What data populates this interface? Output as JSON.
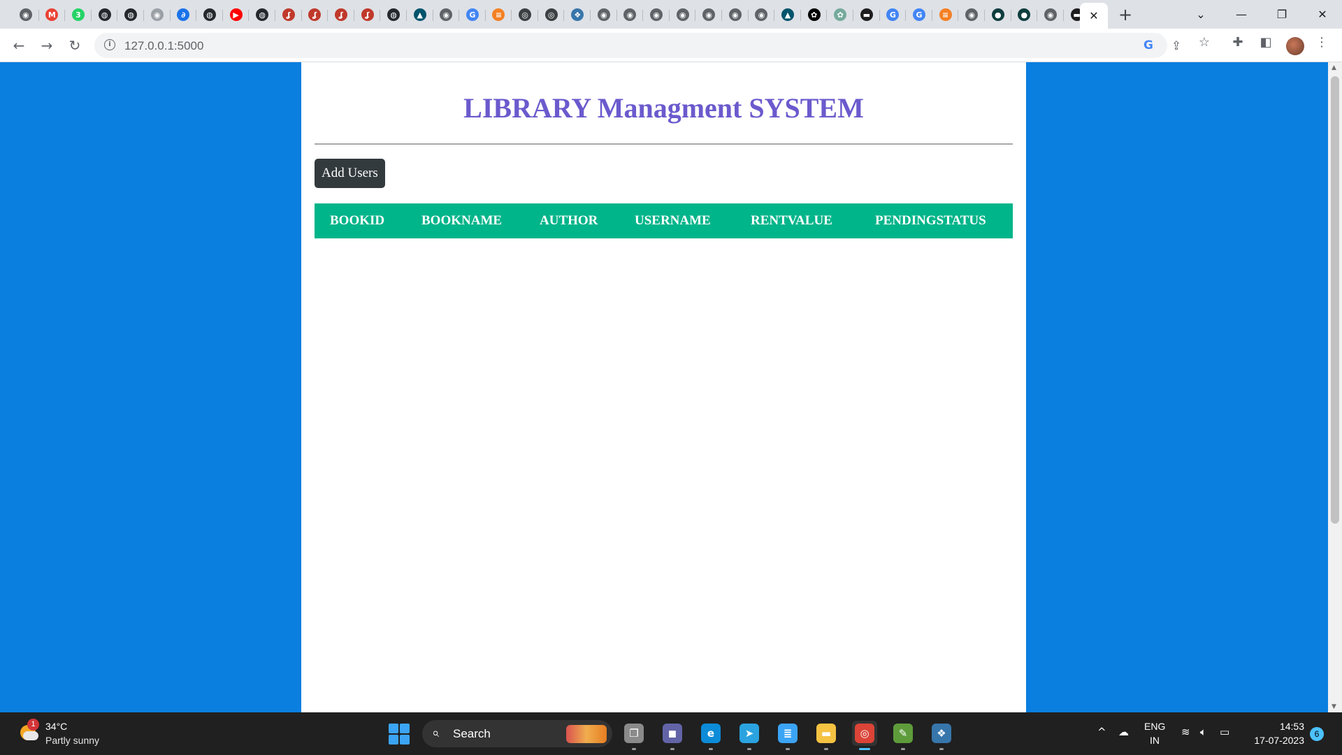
{
  "browser": {
    "url": "127.0.0.1:5000",
    "tabs": [
      {
        "icon": "globe-icon",
        "color": "#5f6368",
        "glyph": "◉"
      },
      {
        "icon": "gmail-icon",
        "color": "#ea4335",
        "glyph": "M"
      },
      {
        "icon": "whatsapp-badge-icon",
        "color": "#25d366",
        "glyph": "3"
      },
      {
        "icon": "github-icon",
        "color": "#24292e",
        "glyph": "◍"
      },
      {
        "icon": "github-icon",
        "color": "#24292e",
        "glyph": "◍"
      },
      {
        "icon": "globe-icon",
        "color": "#9aa0a6",
        "glyph": "◉"
      },
      {
        "icon": "link-icon",
        "color": "#1a73e8",
        "glyph": "∂"
      },
      {
        "icon": "github-icon",
        "color": "#24292e",
        "glyph": "◍"
      },
      {
        "icon": "youtube-icon",
        "color": "#ff0000",
        "glyph": "▶"
      },
      {
        "icon": "github-icon",
        "color": "#24292e",
        "glyph": "◍"
      },
      {
        "icon": "dancer-icon",
        "color": "#c0392b",
        "glyph": "ʆ"
      },
      {
        "icon": "dancer-icon",
        "color": "#c0392b",
        "glyph": "ʆ"
      },
      {
        "icon": "dancer-icon",
        "color": "#c0392b",
        "glyph": "ʆ"
      },
      {
        "icon": "dancer-icon",
        "color": "#c0392b",
        "glyph": "ʆ"
      },
      {
        "icon": "github-icon",
        "color": "#24292e",
        "glyph": "◍"
      },
      {
        "icon": "mysql-icon",
        "color": "#00546b",
        "glyph": "▲"
      },
      {
        "icon": "globe-icon",
        "color": "#5f6368",
        "glyph": "◉"
      },
      {
        "icon": "google-icon",
        "color": "#4285f4",
        "glyph": "G"
      },
      {
        "icon": "stackoverflow-icon",
        "color": "#f48024",
        "glyph": "≡"
      },
      {
        "icon": "chrome-icon",
        "color": "#3c4043",
        "glyph": "◎"
      },
      {
        "icon": "chrome-icon",
        "color": "#3c4043",
        "glyph": "◎"
      },
      {
        "icon": "python-icon",
        "color": "#3776ab",
        "glyph": "❖"
      },
      {
        "icon": "globe-icon",
        "color": "#5f6368",
        "glyph": "◉"
      },
      {
        "icon": "globe-icon",
        "color": "#5f6368",
        "glyph": "◉"
      },
      {
        "icon": "globe-icon",
        "color": "#5f6368",
        "glyph": "◉"
      },
      {
        "icon": "globe-icon",
        "color": "#5f6368",
        "glyph": "◉"
      },
      {
        "icon": "globe-icon",
        "color": "#5f6368",
        "glyph": "◉"
      },
      {
        "icon": "globe-icon",
        "color": "#5f6368",
        "glyph": "◉"
      },
      {
        "icon": "globe-icon",
        "color": "#5f6368",
        "glyph": "◉"
      },
      {
        "icon": "mysql-icon",
        "color": "#00546b",
        "glyph": "▲"
      },
      {
        "icon": "openai-icon",
        "color": "#000000",
        "glyph": "✿"
      },
      {
        "icon": "chatgpt-icon",
        "color": "#74aa9c",
        "glyph": "✿"
      },
      {
        "icon": "terminal-icon",
        "color": "#1e1e1e",
        "glyph": "▬"
      },
      {
        "icon": "google-icon",
        "color": "#4285f4",
        "glyph": "G"
      },
      {
        "icon": "google-icon",
        "color": "#4285f4",
        "glyph": "G"
      },
      {
        "icon": "stackoverflow-icon",
        "color": "#f48024",
        "glyph": "≡"
      },
      {
        "icon": "globe-icon",
        "color": "#5f6368",
        "glyph": "◉"
      },
      {
        "icon": "circle-app-icon",
        "color": "#0f3d3e",
        "glyph": "●"
      },
      {
        "icon": "circle-app-icon",
        "color": "#0f3d3e",
        "glyph": "●"
      },
      {
        "icon": "globe-icon",
        "color": "#5f6368",
        "glyph": "◉"
      },
      {
        "icon": "terminal-icon",
        "color": "#1e1e1e",
        "glyph": "▬"
      }
    ]
  },
  "page": {
    "background": "#0a7fe0",
    "title": "LIBRARY Managment SYSTEM",
    "title_color": "#6a5acd",
    "add_button": "Add Users",
    "table_header_color": "#00b58a",
    "columns": [
      "BOOKID",
      "BOOKNAME",
      "AUTHOR",
      "USERNAME",
      "RENTVALUE",
      "PENDINGSTATUS"
    ],
    "rows": []
  },
  "taskbar": {
    "weather": {
      "temp": "34°C",
      "desc": "Partly sunny",
      "badge": "1"
    },
    "search_label": "Search",
    "apps": [
      {
        "name": "task-view-icon",
        "color": "#8a8a8a",
        "glyph": "❐",
        "active": false
      },
      {
        "name": "teams-icon",
        "color": "#6264a7",
        "glyph": "◼",
        "active": false
      },
      {
        "name": "edge-icon",
        "color": "#0c8cd8",
        "glyph": "e",
        "active": false
      },
      {
        "name": "telegram-icon",
        "color": "#2aa3e0",
        "glyph": "➤",
        "active": false
      },
      {
        "name": "notepad-icon",
        "color": "#3ba4f5",
        "glyph": "≣",
        "active": false
      },
      {
        "name": "file-explorer-icon",
        "color": "#f5c242",
        "glyph": "▬",
        "active": false
      },
      {
        "name": "chrome-icon",
        "color": "#db4437",
        "glyph": "◎",
        "active": true
      },
      {
        "name": "image-editor-icon",
        "color": "#5e9c3b",
        "glyph": "✎",
        "active": false
      },
      {
        "name": "python-icon",
        "color": "#3776ab",
        "glyph": "❖",
        "active": false
      }
    ],
    "language": {
      "line1": "ENG",
      "line2": "IN"
    },
    "time": "14:53",
    "date": "17-07-2023",
    "notifications": "6"
  }
}
